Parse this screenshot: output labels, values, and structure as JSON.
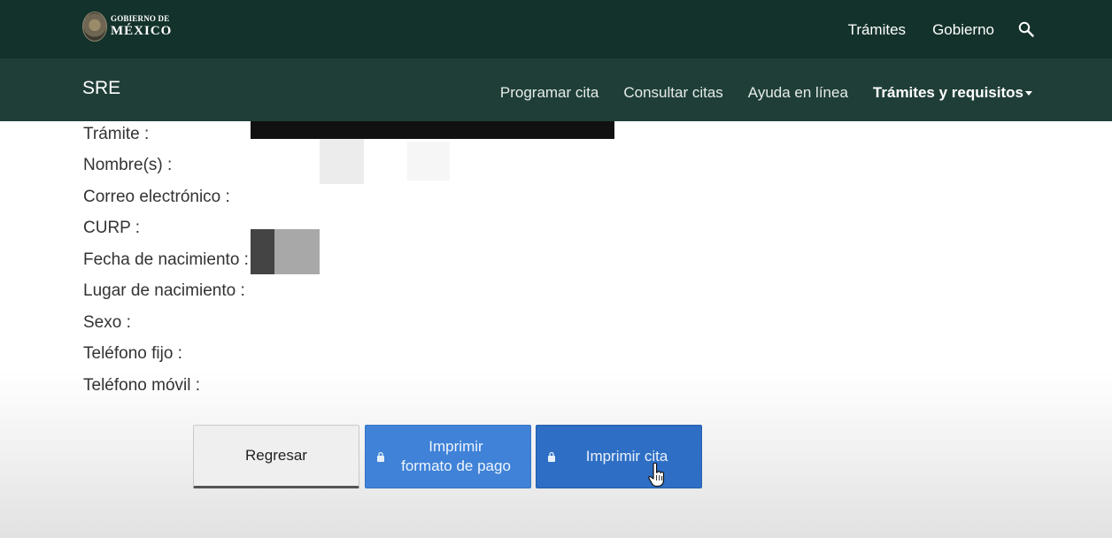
{
  "gov_header": {
    "logo_small": "GOBIERNO DE",
    "logo_big": "MÉXICO",
    "nav": [
      "Trámites",
      "Gobierno"
    ],
    "search_icon": "search-icon"
  },
  "sub_header": {
    "brand": "SRE",
    "nav": [
      "Programar cita",
      "Consultar citas",
      "Ayuda en línea",
      "Trámites y requisitos"
    ]
  },
  "form": {
    "labels": [
      "Trámite :",
      "Nombre(s) :",
      "Correo electrónico :",
      "CURP :",
      "Fecha de nacimiento :",
      "Lugar de nacimiento :",
      "Sexo :",
      "Teléfono fijo :",
      "Teléfono móvil :"
    ]
  },
  "buttons": {
    "back": "Regresar",
    "print_payment_line1": "Imprimir",
    "print_payment_line2": "formato de pago",
    "print_appointment": "Imprimir cita"
  },
  "colors": {
    "gov_bar": "#13322b",
    "sub_bar": "#1f3e38",
    "button_blue": "#3f82d8",
    "button_blue_dark": "#2e6fc5"
  }
}
